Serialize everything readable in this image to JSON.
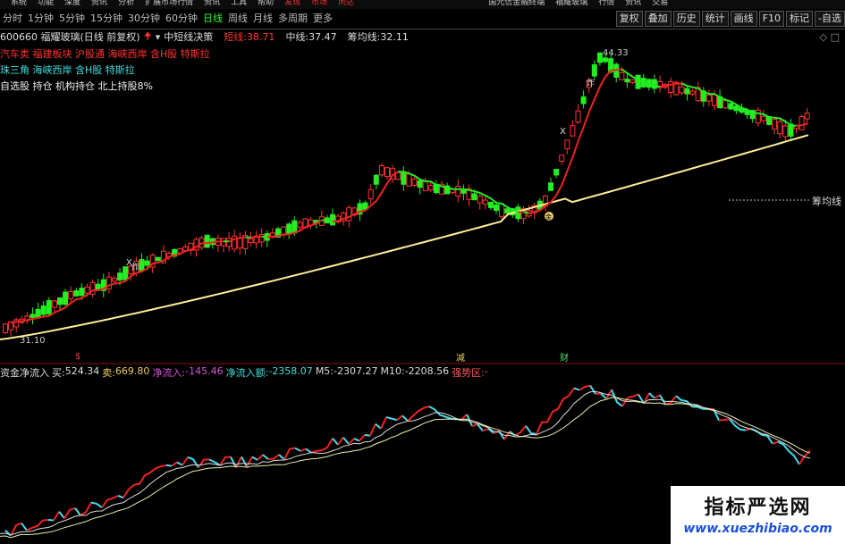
{
  "menu": [
    "系统",
    "功能",
    "深度",
    "资讯",
    "分析",
    "扩展市场行情",
    "资讯",
    "工具",
    "帮助",
    "发现",
    "市场",
    "问达",
    "国元信金融终端",
    "福耀玻璃",
    "行情",
    "资讯",
    "交易"
  ],
  "periods": [
    {
      "label": "分时",
      "active": false
    },
    {
      "label": "1分钟",
      "active": false
    },
    {
      "label": "5分钟",
      "active": false
    },
    {
      "label": "15分钟",
      "active": false
    },
    {
      "label": "30分钟",
      "active": false
    },
    {
      "label": "60分钟",
      "active": false
    },
    {
      "label": "日线",
      "active": true
    },
    {
      "label": "周线",
      "active": false
    },
    {
      "label": "月线",
      "active": false
    },
    {
      "label": "多周期",
      "active": false
    },
    {
      "label": "更多",
      "active": false
    }
  ],
  "tools": [
    "复权",
    "叠加",
    "历史",
    "统计",
    "画线",
    "F10",
    "标记",
    "-自选"
  ],
  "info": {
    "code": "600660 福耀玻璃(日线 前复权)",
    "indicator": "中短线决策",
    "short_label": "短线:",
    "short_value": "38.71",
    "mid_label": "中线:",
    "mid_value": "37.47",
    "cost_label": "筹均线:",
    "cost_value": "32.11"
  },
  "tags": {
    "line1": "汽车类 福建板块 沪股通 海峡西岸 含H股 特斯拉",
    "line2": "珠三角 海峡西岸 含H股 特斯拉",
    "line3": "自选股 持仓 机构持仓 北上持股8%"
  },
  "chart_annotations": {
    "high_label": "44.33",
    "low_label": "31.10",
    "cost_line_label": "筹均线",
    "marker_x": "X",
    "marker_zha": "炸",
    "marker_dollar": "$",
    "marker_jian": "减",
    "marker_cai": "财",
    "marker_coin": "金"
  },
  "sub_indicator": {
    "title": "资金净流入",
    "buy_label": "买:",
    "buy_value": "524.34",
    "sell_label": "卖:",
    "sell_value": "669.80",
    "net_label": "净流入:",
    "net_value": "-145.46",
    "net_amount_label": "净流入额:",
    "net_amount_value": "-2358.07",
    "m5_label": "M5:",
    "m5_value": "-2307.27",
    "m10_label": "M10:",
    "m10_value": "-2208.56",
    "zone_label": "强势区:",
    "zone_value": "-"
  },
  "watermark": {
    "title": "指标严选网",
    "url": "www.xuezhibiao.com"
  },
  "colors": {
    "up": "#ff3333",
    "down": "#22ee22",
    "short_line": "#ee2222",
    "mid_line": "#22ee22",
    "cost_line": "#ffee99",
    "flow_up": "#ee2222",
    "flow_down": "#44ddee",
    "m5": "#dddddd",
    "m10": "#eeeeaa"
  }
}
